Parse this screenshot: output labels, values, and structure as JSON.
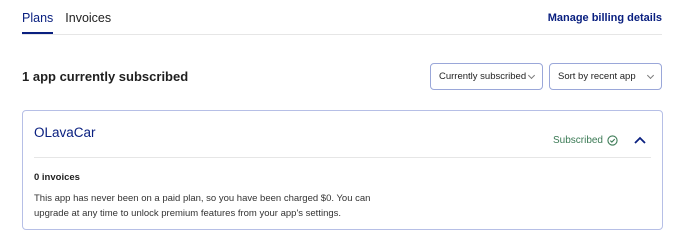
{
  "tabs": [
    {
      "label": "Plans",
      "active": true
    },
    {
      "label": "Invoices",
      "active": false
    }
  ],
  "header": {
    "manage_link": "Manage billing details"
  },
  "summary": {
    "title": "1 app currently subscribed"
  },
  "filters": {
    "status_select": "Currently subscribed",
    "sort_select": "Sort by recent app"
  },
  "app_card": {
    "name": "OLavaCar",
    "status": "Subscribed",
    "status_icon": "check-circle-icon",
    "collapse_icon": "chevron-up-icon",
    "invoices_count": "0 invoices",
    "message": "This app has never been on a paid plan, so you have been charged $0. You can upgrade at any time to unlock premium features from your app's settings."
  },
  "colors": {
    "accent": "#0a2080",
    "status_green": "#3b7a55",
    "border": "#b6bfe6"
  }
}
